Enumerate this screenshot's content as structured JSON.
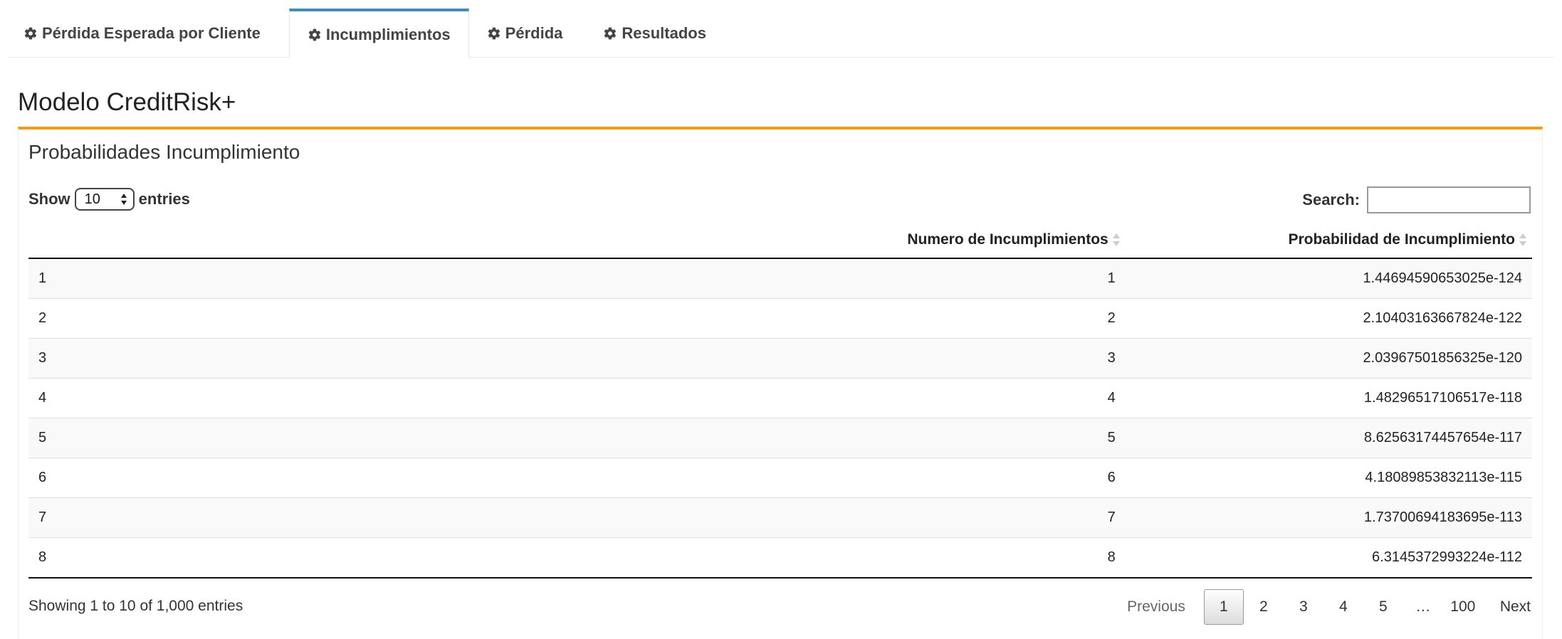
{
  "tabs": [
    {
      "label": "Pérdida Esperada por Cliente",
      "icon": "gear-icon",
      "active": false
    },
    {
      "label": "Incumplimientos",
      "icon": "gear-icon",
      "active": true
    },
    {
      "label": "Pérdida",
      "icon": "gear-icon",
      "active": false
    },
    {
      "label": "Resultados",
      "icon": "gear-icon",
      "active": false
    }
  ],
  "page_title": "Modelo CreditRisk+",
  "box": {
    "title": "Probabilidades Incumplimiento",
    "accent_color": "#f39c12"
  },
  "length": {
    "show_label": "Show",
    "value": "10",
    "entries_label": "entries"
  },
  "search": {
    "label": "Search:",
    "value": ""
  },
  "table": {
    "columns": [
      "",
      "Numero de Incumplimientos",
      "Probabilidad de Incumplimiento"
    ],
    "rows": [
      {
        "idx": "1",
        "num": "1",
        "prob": "1.44694590653025e-124"
      },
      {
        "idx": "2",
        "num": "2",
        "prob": "2.10403163667824e-122"
      },
      {
        "idx": "3",
        "num": "3",
        "prob": "2.03967501856325e-120"
      },
      {
        "idx": "4",
        "num": "4",
        "prob": "1.48296517106517e-118"
      },
      {
        "idx": "5",
        "num": "5",
        "prob": "8.62563174457654e-117"
      },
      {
        "idx": "6",
        "num": "6",
        "prob": "4.18089853832113e-115"
      },
      {
        "idx": "7",
        "num": "7",
        "prob": "1.73700694183695e-113"
      },
      {
        "idx": "8",
        "num": "8",
        "prob": "6.3145372993224e-112"
      }
    ]
  },
  "info": "Showing 1 to 10 of 1,000 entries",
  "pagination": {
    "previous": "Previous",
    "pages": [
      "1",
      "2",
      "3",
      "4",
      "5",
      "…",
      "100"
    ],
    "current": "1",
    "next": "Next"
  },
  "colors": {
    "active_tab": "#3c8dbc",
    "box_border": "#f39c12"
  }
}
